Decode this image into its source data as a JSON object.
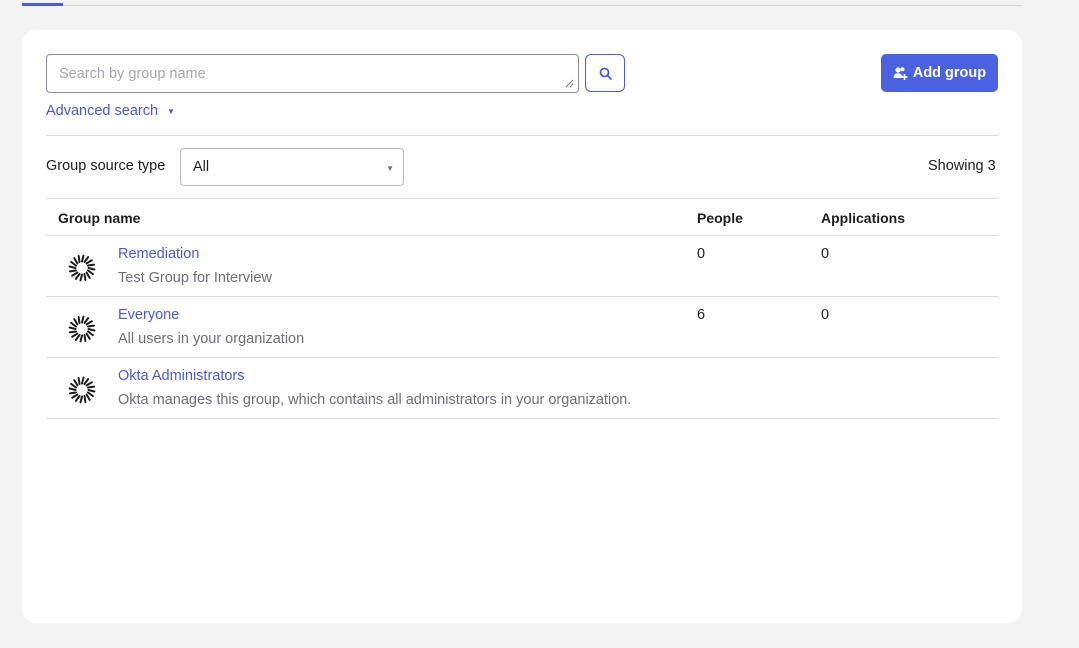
{
  "search": {
    "placeholder": "Search by group name"
  },
  "toolbar": {
    "add_group_label": "Add group",
    "advanced_search_label": "Advanced search"
  },
  "filter": {
    "label": "Group source type",
    "selected": "All"
  },
  "showing_text": "Showing 3",
  "table": {
    "headers": {
      "name": "Group name",
      "people": "People",
      "applications": "Applications"
    },
    "rows": [
      {
        "name": "Remediation",
        "description": "Test Group for Interview",
        "people": "0",
        "applications": "0"
      },
      {
        "name": "Everyone",
        "description": "All users in your organization",
        "people": "6",
        "applications": "0"
      },
      {
        "name": "Okta Administrators",
        "description": "Okta manages this group, which contains all administrators in your organization.",
        "people": "",
        "applications": ""
      }
    ]
  },
  "colors": {
    "accent": "#4b5ad6",
    "button_bg": "#4b62e0",
    "page_bg": "#f3f3f3"
  },
  "icons": {
    "search": "search-icon",
    "add_group": "add-group-icon",
    "group": "okta-group-icon"
  }
}
